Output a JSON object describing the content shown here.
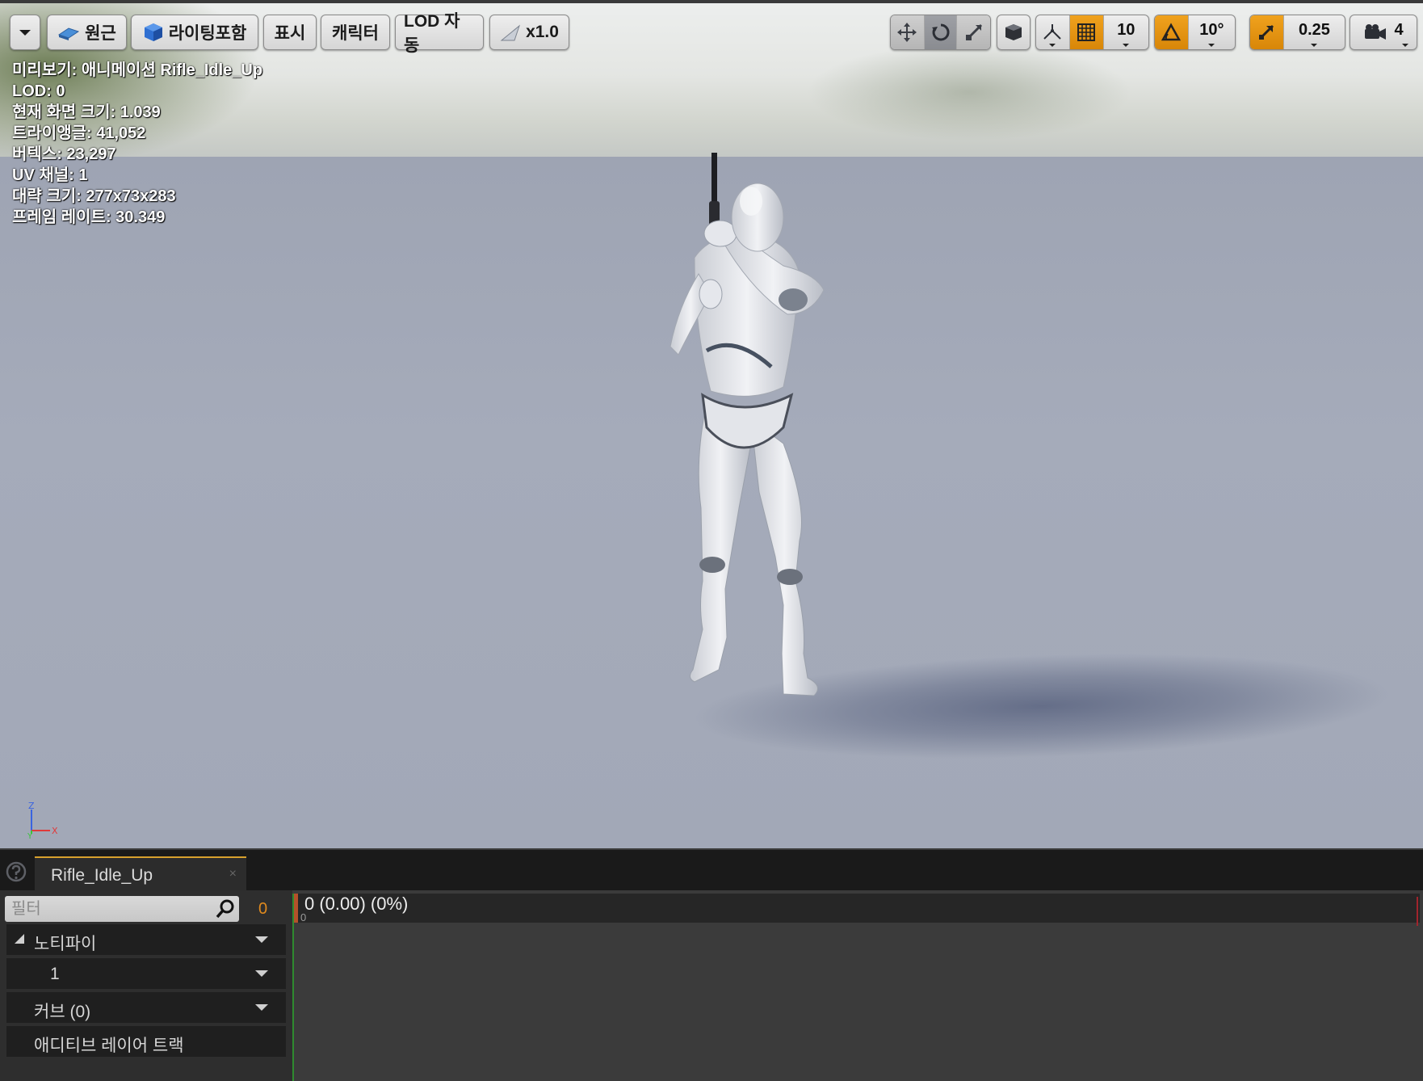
{
  "toolbar": {
    "perspective_label": "원근",
    "lighting_label": "라이팅포함",
    "show_label": "표시",
    "character_label": "캐릭터",
    "lod_label": "LOD 자동",
    "speed_label": "x1.0",
    "grid_snap_value": "10",
    "rotation_snap_value": "10°",
    "scale_snap_value": "0.25",
    "camera_speed_value": "4",
    "accent_color": "#e08e0b"
  },
  "stats": {
    "lines": [
      "미리보기: 애니메이션 Rifle_Idle_Up",
      "LOD: 0",
      "현재 화면 크기: 1.039",
      "트라이앵글: 41,052",
      "버텍스: 23,297",
      "UV 채널: 1",
      "대략 크기: 277x73x283",
      "프레임 레이트: 30.349"
    ]
  },
  "axis": {
    "z": "Z",
    "x": "X",
    "y": "Y"
  },
  "tab": {
    "title": "Rifle_Idle_Up",
    "close": "×"
  },
  "panel": {
    "filter_placeholder": "필터",
    "frame_number": "0",
    "tracks": [
      {
        "label": "노티파이"
      },
      {
        "label": "1"
      },
      {
        "label": "커브  (0)"
      },
      {
        "label": "애디티브 레이어 트랙"
      }
    ]
  },
  "timeline": {
    "readout": "0 (0.00) (0%)",
    "tick_label": "0"
  }
}
